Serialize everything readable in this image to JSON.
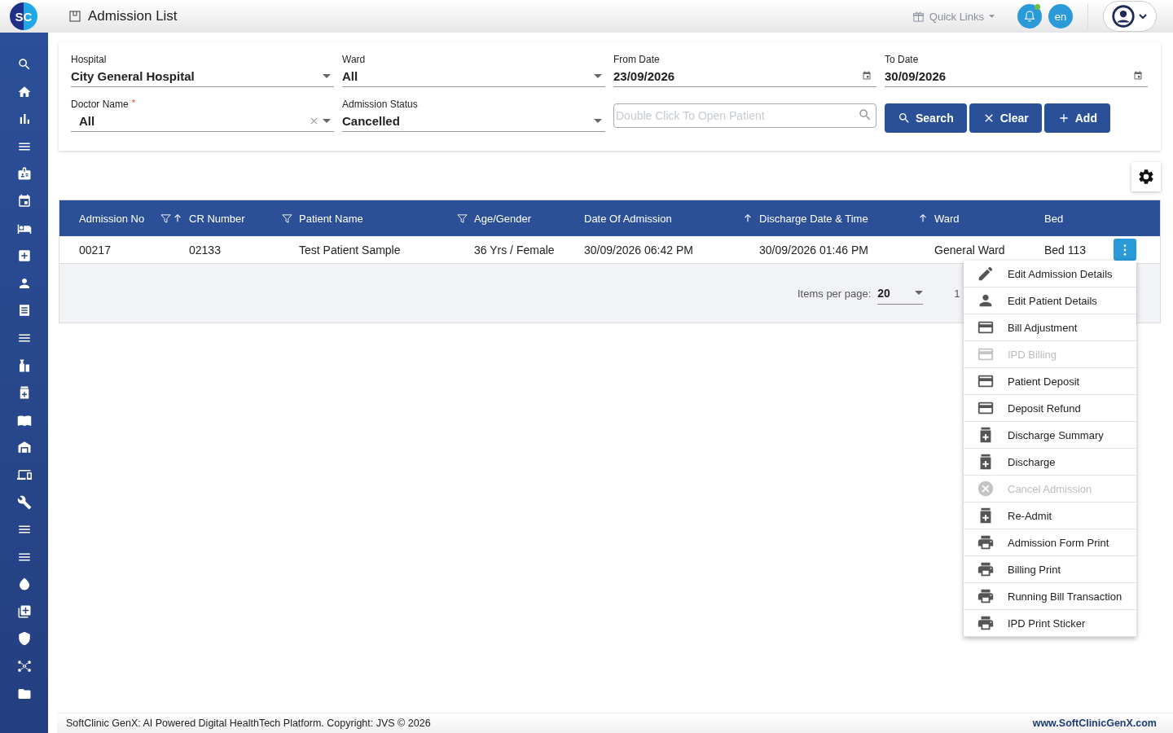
{
  "app": {
    "logo": "SC",
    "title": "Admission List",
    "quick_links": "Quick Links",
    "language": "en",
    "notification_dot": true
  },
  "filters": [
    {
      "label": "Hospital",
      "value": "City General Hospital",
      "kind": "select",
      "clearable": false
    },
    {
      "label": "Ward",
      "value": "All",
      "kind": "select",
      "clearable": false
    },
    {
      "label": "From Date",
      "value": "23/09/2026",
      "kind": "date",
      "clearable": false
    },
    {
      "label": "To Date",
      "value": "30/09/2026",
      "kind": "date",
      "clearable": false
    },
    {
      "label": "Doctor Name",
      "required_mark": "*",
      "value": "All",
      "kind": "select",
      "clearable": true
    },
    {
      "label": "Admission Status",
      "value": "Cancelled",
      "kind": "select",
      "clearable": false
    }
  ],
  "patient_search": {
    "placeholder": "Double Click To Open Patient"
  },
  "buttons": [
    {
      "label": "Search",
      "kind": "search"
    },
    {
      "label": "Clear",
      "kind": "clear"
    },
    {
      "label": "Add",
      "kind": "add"
    }
  ],
  "table": {
    "columns": [
      {
        "label": "Admission No",
        "filter": true,
        "sort": true
      },
      {
        "label": "CR Number",
        "filter": true,
        "sort": false
      },
      {
        "label": "Patient Name",
        "filter": true,
        "sort": false
      },
      {
        "label": "Age/Gender",
        "filter": false,
        "sort": false
      },
      {
        "label": "Date Of Admission",
        "filter": false,
        "sort": true
      },
      {
        "label": "Discharge Date & Time",
        "filter": false,
        "sort": true
      },
      {
        "label": "Ward",
        "filter": false,
        "sort": false
      },
      {
        "label": "Bed",
        "filter": false,
        "sort": false
      }
    ],
    "rows": [
      [
        "00217",
        "02133",
        "Test Patient Sample",
        "36 Yrs / Female",
        "30/09/2026 06:42 PM",
        "30/09/2026 01:46 PM",
        "General Ward",
        "Bed 113"
      ]
    ]
  },
  "paginator": {
    "label": "Items per page:",
    "page_size": "20",
    "range": "1"
  },
  "action_menu": [
    {
      "label": "Edit Admission Details",
      "kind": "edit",
      "disabled": false
    },
    {
      "label": "Edit Patient Details",
      "kind": "person",
      "disabled": false
    },
    {
      "label": "Bill Adjustment",
      "kind": "card",
      "disabled": false
    },
    {
      "label": "IPD Billing",
      "kind": "card",
      "disabled": true
    },
    {
      "label": "Patient Deposit",
      "kind": "card",
      "disabled": false
    },
    {
      "label": "Deposit Refund",
      "kind": "card",
      "disabled": false
    },
    {
      "label": "Discharge Summary",
      "kind": "medical",
      "disabled": false
    },
    {
      "label": "Discharge",
      "kind": "medical",
      "disabled": false
    },
    {
      "label": "Cancel Admission",
      "kind": "cancel",
      "disabled": true
    },
    {
      "label": "Re-Admit",
      "kind": "medical",
      "disabled": false
    },
    {
      "label": "Admission Form Print",
      "kind": "print",
      "disabled": false
    },
    {
      "label": "Billing Print",
      "kind": "print",
      "disabled": false
    },
    {
      "label": "Running Bill Transaction",
      "kind": "print",
      "disabled": false
    },
    {
      "label": "IPD Print Sticker",
      "kind": "print",
      "disabled": false
    }
  ],
  "footer": {
    "text": "SoftClinic GenX: AI Powered Digital HealthTech Platform. Copyright: JVS © 2026",
    "link": "www.SoftClinicGenX.com"
  }
}
